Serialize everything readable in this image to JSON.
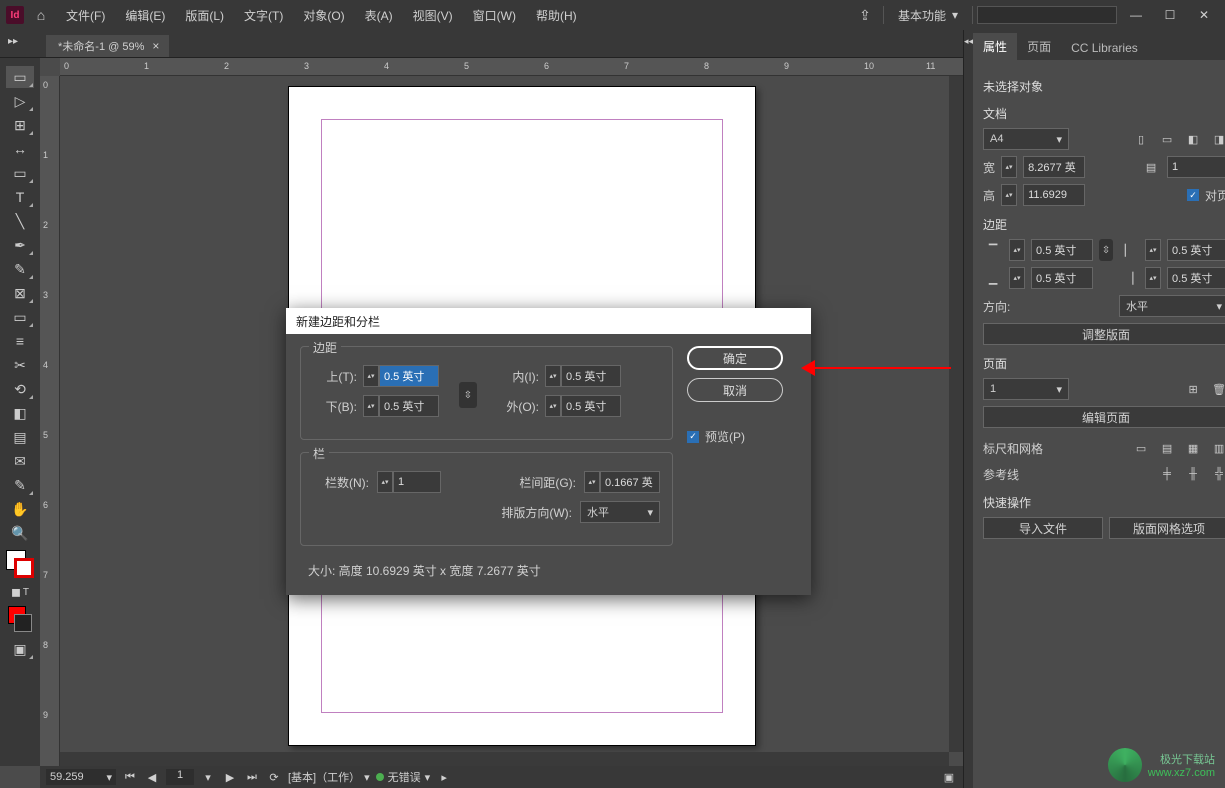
{
  "menu": {
    "logo_text": "Id",
    "items": [
      "文件(F)",
      "编辑(E)",
      "版面(L)",
      "文字(T)",
      "对象(O)",
      "表(A)",
      "视图(V)",
      "窗口(W)",
      "帮助(H)"
    ],
    "workspace": "基本功能",
    "min": "—",
    "max": "☐",
    "close": "✕"
  },
  "tab": {
    "title": "*未命名-1 @ 59%",
    "close": "×"
  },
  "ruler_h": [
    "0",
    "1",
    "2",
    "3",
    "4",
    "5",
    "6",
    "7",
    "8",
    "9",
    "10",
    "11"
  ],
  "ruler_v": [
    "0",
    "1",
    "2",
    "3",
    "4",
    "5",
    "6",
    "7",
    "8",
    "9"
  ],
  "dialog": {
    "title": "新建边距和分栏",
    "margin_legend": "边距",
    "top_label": "上(T):",
    "top_value": "0.5 英寸",
    "bottom_label": "下(B):",
    "bottom_value": "0.5 英寸",
    "inside_label": "内(I):",
    "inside_value": "0.5 英寸",
    "outside_label": "外(O):",
    "outside_value": "0.5 英寸",
    "col_legend": "栏",
    "count_label": "栏数(N):",
    "count_value": "1",
    "gutter_label": "栏间距(G):",
    "gutter_value": "0.1667 英",
    "dir_label": "排版方向(W):",
    "dir_value": "水平",
    "ok": "确定",
    "cancel": "取消",
    "preview": "预览(P)",
    "size_line": "大小: 高度 10.6929 英寸 x 宽度 7.2677 英寸"
  },
  "panel": {
    "tabs": [
      "属性",
      "页面",
      "CC Libraries"
    ],
    "noselect": "未选择对象",
    "doc_label": "文档",
    "preset": "A4",
    "w_label": "宽",
    "w_value": "8.2677 英",
    "h_label": "高",
    "h_value": "11.6929",
    "pages_value": "1",
    "facing": "对页",
    "margin_label": "边距",
    "m_top": "0.5 英寸",
    "m_bottom": "0.5 英寸",
    "m_in": "0.5 英寸",
    "m_out": "0.5 英寸",
    "orient_label": "方向:",
    "orient_value": "水平",
    "adjust_btn": "调整版面",
    "page_label": "页面",
    "page_value": "1",
    "edit_pages": "编辑页面",
    "rulers_label": "标尺和网格",
    "guides_label": "参考线",
    "quick_label": "快速操作",
    "import_btn": "导入文件",
    "grid_btn": "版面网格选项"
  },
  "status": {
    "zoom": "59.259",
    "page": "1",
    "mode": "[基本]（工作）",
    "errors": "无错误"
  },
  "watermark_text": "www.xz7.com"
}
